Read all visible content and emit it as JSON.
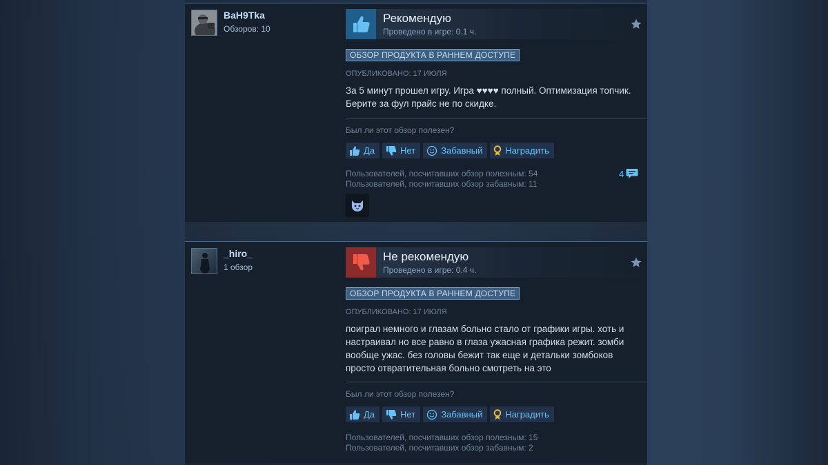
{
  "colors": {
    "accent_link": "#67c1f5",
    "recommended": "#1f5e8a",
    "not_recommended": "#8c2b2b"
  },
  "reviews": [
    {
      "author_name": "BaH9Tka",
      "author_reviews": "Обзоров: 10",
      "avatar_icon": "avatar-character-icon",
      "verdict": "Рекомендую",
      "verdict_icon": "thumbs-up-icon",
      "hours": "Проведено в игре: 0.1 ч.",
      "early_access": "ОБЗОР ПРОДУКТА В РАННЕМ ДОСТУПЕ",
      "posted": "ОПУБЛИКОВАНО: 17 ИЮЛЯ",
      "text": "За 5 минут прошел игру. Игра ♥♥♥♥ полный. Оптимизация топчик. Берите за фул прайс не по скидке.",
      "helpful_question": "Был ли этот обзор полезен?",
      "buttons": {
        "yes": "Да",
        "no": "Нет",
        "funny": "Забавный",
        "award": "Наградить"
      },
      "helpful_stat": "Пользователей, посчитавших обзор полезным: 54",
      "funny_stat": "Пользователей, посчитавших обзор забавным: 11",
      "comment_count": "4",
      "award_icon": "cat-award-icon"
    },
    {
      "author_name": "_hiro_",
      "author_reviews": "1 обзор",
      "avatar_icon": "avatar-figure-icon",
      "verdict": "Не рекомендую",
      "verdict_icon": "thumbs-down-icon",
      "hours": "Проведено в игре: 0.4 ч.",
      "early_access": "ОБЗОР ПРОДУКТА В РАННЕМ ДОСТУПЕ",
      "posted": "ОПУБЛИКОВАНО: 17 ИЮЛЯ",
      "text": "поиграл немного и глазам больно стало от графики игры. хоть и настраивал но все равно в глаза ужасная графика режит. зомби вообще ужас. без головы бежит так еще и детальки зомбоков просто отвратительная больно смотреть на это",
      "helpful_question": "Был ли этот обзор полезен?",
      "buttons": {
        "yes": "Да",
        "no": "Нет",
        "funny": "Забавный",
        "award": "Наградить"
      },
      "helpful_stat": "Пользователей, посчитавших обзор полезным: 15",
      "funny_stat": "Пользователей, посчитавших обзор забавным: 2"
    }
  ]
}
